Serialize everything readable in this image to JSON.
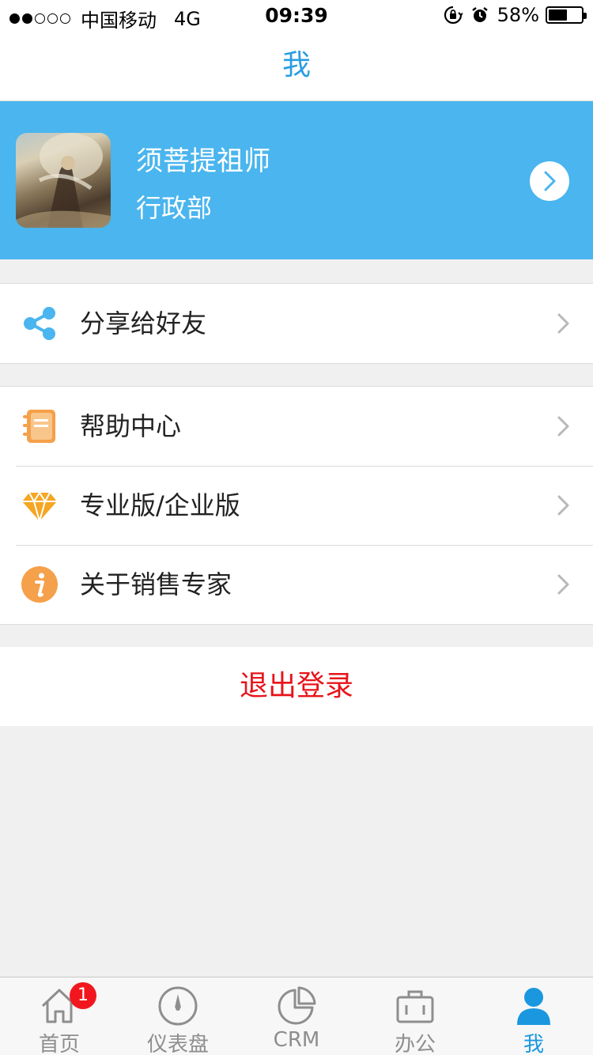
{
  "status_bar": {
    "carrier": "中国移动",
    "network": "4G",
    "time": "09:39",
    "battery_percent": "58%",
    "battery_level": 0.58,
    "signal_bars_filled": 2,
    "signal_bars_total": 5,
    "icons": [
      "rotation-lock-icon",
      "alarm-icon",
      "battery-icon"
    ]
  },
  "nav": {
    "title": "我"
  },
  "profile": {
    "name": "须菩提祖师",
    "department": "行政部",
    "background_color": "#4ab5ee"
  },
  "menu": {
    "share": {
      "label": "分享给好友",
      "icon": "share-icon"
    },
    "help": {
      "label": "帮助中心",
      "icon": "notebook-icon"
    },
    "pro": {
      "label": "专业版/企业版",
      "icon": "diamond-icon"
    },
    "about": {
      "label": "关于销售专家",
      "icon": "info-icon"
    }
  },
  "logout": {
    "label": "退出登录",
    "color": "#e8141b"
  },
  "tabs": [
    {
      "label": "首页",
      "icon": "home-icon",
      "badge": "1"
    },
    {
      "label": "仪表盘",
      "icon": "dashboard-icon"
    },
    {
      "label": "CRM",
      "icon": "pie-chart-icon"
    },
    {
      "label": "办公",
      "icon": "briefcase-icon"
    },
    {
      "label": "我",
      "icon": "person-icon",
      "active": true
    }
  ],
  "colors": {
    "accent": "#1b97e0",
    "badge": "#f2171f",
    "icon_orange": "#f5a04a",
    "share_blue": "#4ab5ee"
  }
}
